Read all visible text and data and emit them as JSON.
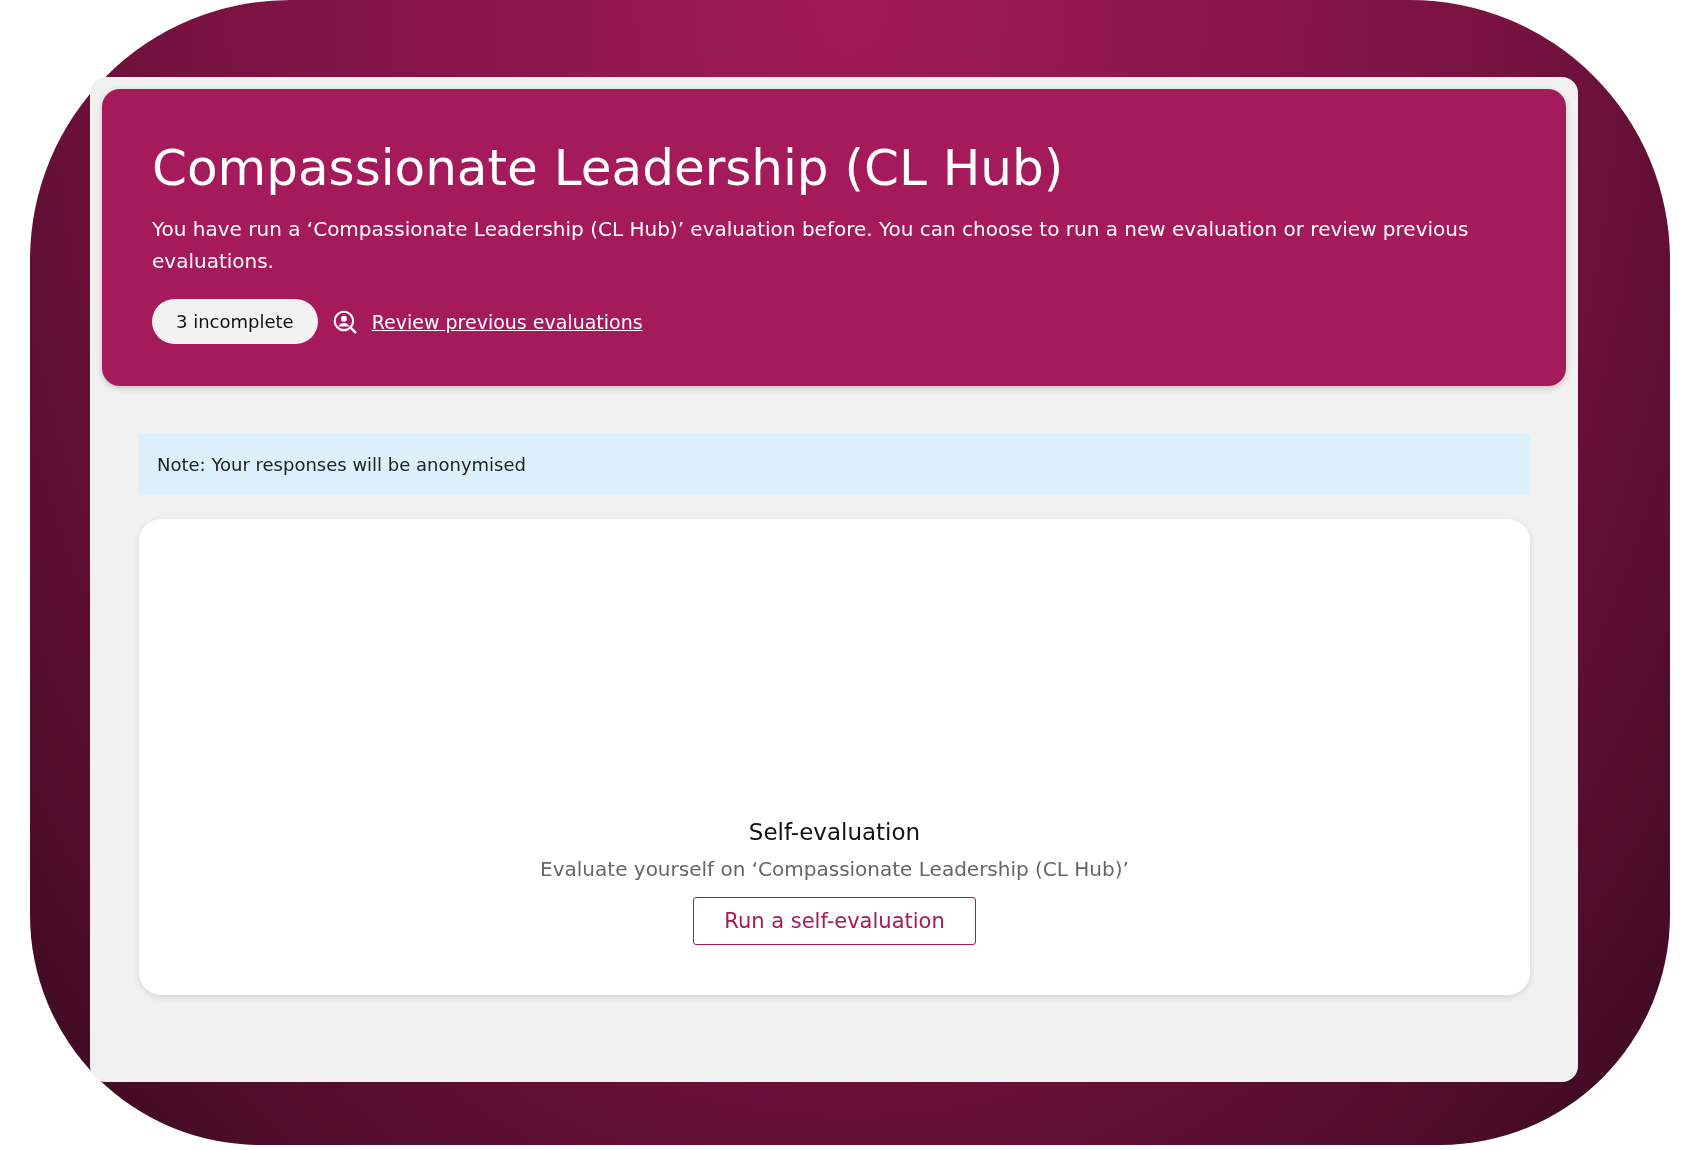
{
  "header": {
    "title": "Compassionate Leadership (CL Hub)",
    "description": "You have run a ‘Compassionate Leadership (CL Hub)’ evaluation before. You can choose to run a new evaluation or review previous evaluations.",
    "badge": "3 incomplete",
    "link": "Review previous evaluations"
  },
  "note": "Note: Your responses will be anonymised",
  "card": {
    "title": "Self-evaluation",
    "subtitle": "Evaluate yourself on ‘Compassionate Leadership (CL Hub)’",
    "button": "Run a self-evaluation"
  }
}
